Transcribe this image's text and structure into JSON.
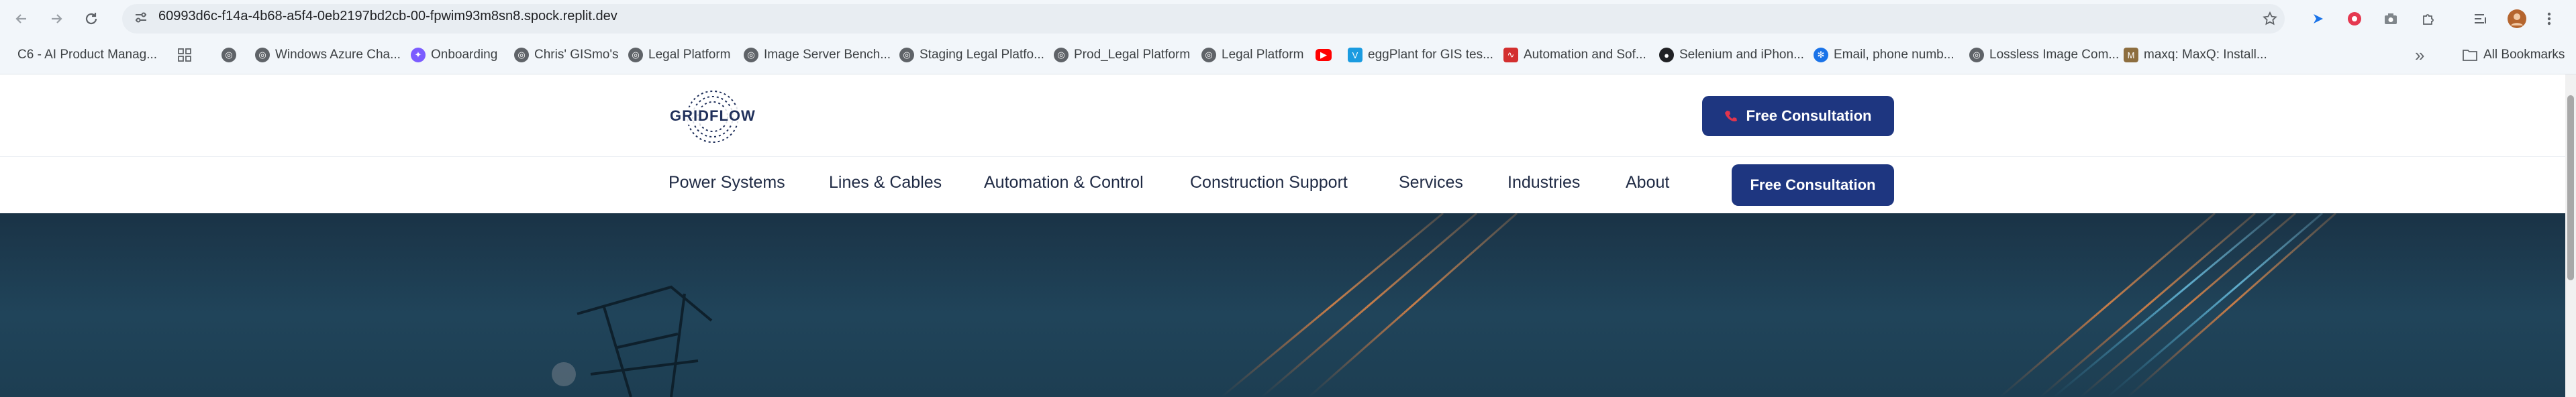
{
  "browser": {
    "url": "60993d6c-f14a-4b68-a5f4-0eb2197bd2cb-00-fpwim93m8sn8.spock.replit.dev",
    "bookmarks": [
      {
        "label": "C6 - AI Product Manag...",
        "icon": "c6-icon",
        "color": "#3b3b3b"
      },
      {
        "label": "",
        "icon": "apps-grid-icon",
        "color": "#5f6368"
      },
      {
        "label": "",
        "icon": "globe-icon",
        "color": "#5f6368"
      },
      {
        "label": "Windows Azure Cha...",
        "icon": "globe-icon",
        "color": "#5f6368"
      },
      {
        "label": "Onboarding",
        "icon": "onboarding-icon",
        "color": "#7b5cff"
      },
      {
        "label": "Chris' GISmo's",
        "icon": "globe-icon",
        "color": "#5f6368"
      },
      {
        "label": "Legal Platform",
        "icon": "globe-icon",
        "color": "#5f6368"
      },
      {
        "label": "Image Server Bench...",
        "icon": "globe-icon",
        "color": "#5f6368"
      },
      {
        "label": "Staging Legal Platfo...",
        "icon": "globe-icon",
        "color": "#5f6368"
      },
      {
        "label": "Prod_Legal Platform",
        "icon": "globe-icon",
        "color": "#5f6368"
      },
      {
        "label": "Legal Platform",
        "icon": "globe-icon",
        "color": "#5f6368"
      },
      {
        "label": "",
        "icon": "youtube-icon",
        "color": "#ff0000"
      },
      {
        "label": "eggPlant for GIS tes...",
        "icon": "eggplant-icon",
        "color": "#1a9be0"
      },
      {
        "label": "Automation and Sof...",
        "icon": "waveform-icon",
        "color": "#d32f2f"
      },
      {
        "label": "Selenium and iPhon...",
        "icon": "github-icon",
        "color": "#202124"
      },
      {
        "label": "Email, phone numb...",
        "icon": "gear-icon",
        "color": "#1a73e8"
      },
      {
        "label": "Lossless Image Com...",
        "icon": "globe-icon",
        "color": "#5f6368"
      },
      {
        "label": "maxq: MaxQ: Install...",
        "icon": "maxq-icon",
        "color": "#8d6e3f"
      }
    ],
    "all_bookmarks_label": "All Bookmarks"
  },
  "site": {
    "logo_text": "GRIDFLOW",
    "header_cta": "Free Consultation",
    "nav": [
      "Power Systems",
      "Lines & Cables",
      "Automation & Control",
      "Construction Support",
      "Services",
      "Industries",
      "About"
    ],
    "nav_cta": "Free Consultation"
  },
  "colors": {
    "accent": "#1e3680",
    "phone_icon": "#e2354d",
    "hero": "#1d3e52"
  }
}
